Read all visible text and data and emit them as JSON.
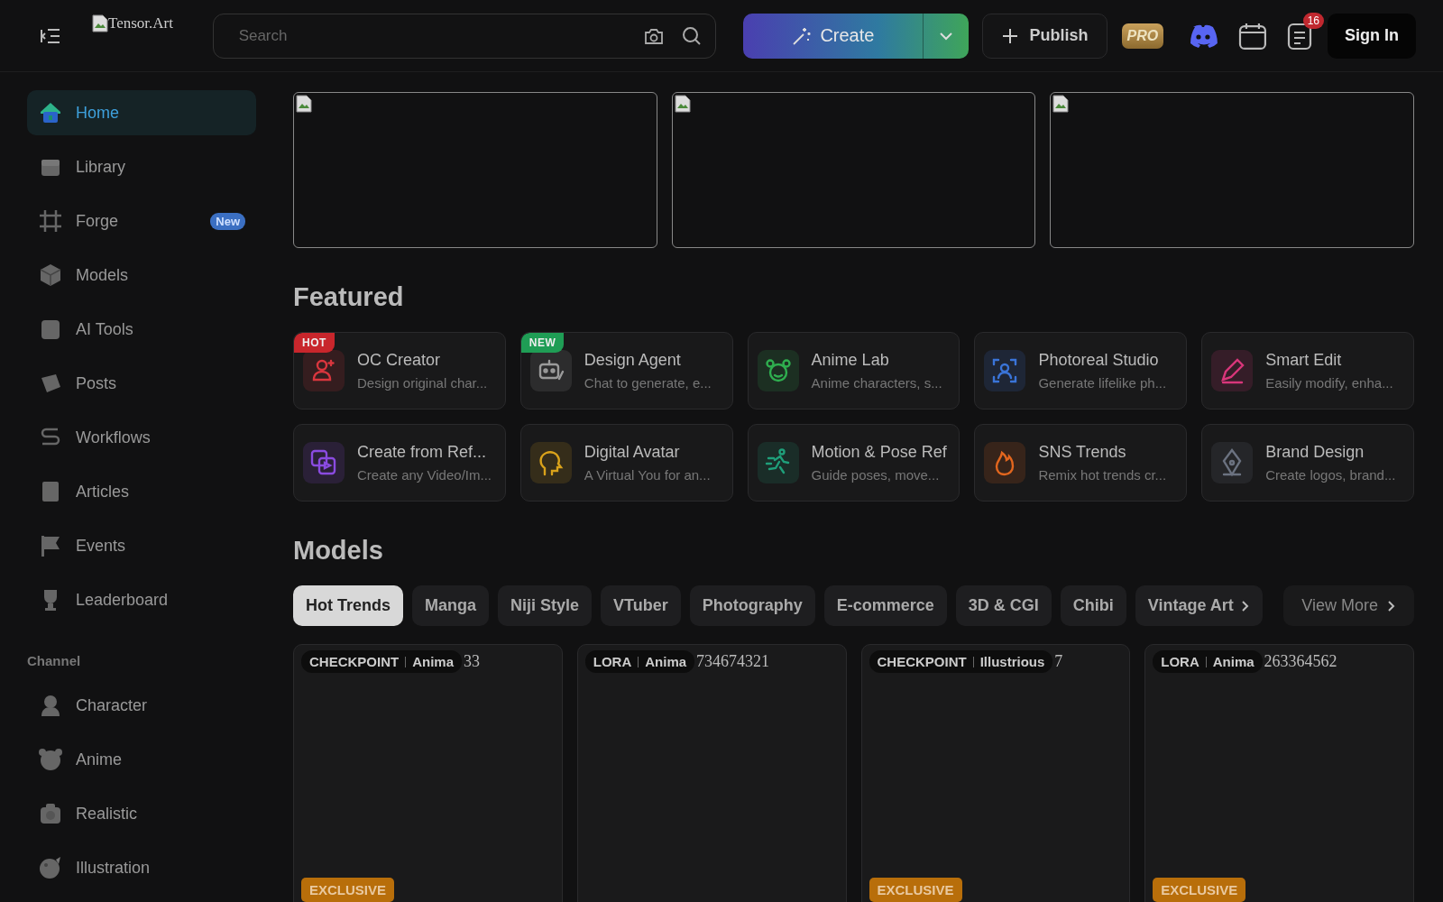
{
  "header": {
    "logo_alt": "Tensor.Art",
    "search": {
      "placeholder": "Search"
    },
    "create_button": "Create",
    "publish_button": "Publish",
    "pro_badge": "PRO",
    "notification_count": "16",
    "sign_in": "Sign In"
  },
  "sidebar": {
    "items": [
      {
        "label": "Home",
        "selected": true
      },
      {
        "label": "Library",
        "selected": false
      },
      {
        "label": "Forge",
        "selected": false,
        "badge": "New"
      },
      {
        "label": "Models",
        "selected": false
      },
      {
        "label": "AI Tools",
        "selected": false
      },
      {
        "label": "Posts",
        "selected": false
      },
      {
        "label": "Workflows",
        "selected": false
      },
      {
        "label": "Articles",
        "selected": false
      },
      {
        "label": "Events",
        "selected": false
      },
      {
        "label": "Leaderboard",
        "selected": false
      }
    ],
    "channel_heading": "Channel",
    "channels": [
      {
        "label": "Character",
        "selected": false
      },
      {
        "label": "Anime",
        "selected": false
      },
      {
        "label": "Realistic",
        "selected": false
      },
      {
        "label": "Illustration",
        "selected": false
      }
    ]
  },
  "banners": [
    {
      "kind": "broken-image"
    },
    {
      "kind": "broken-image"
    },
    {
      "kind": "broken-image"
    }
  ],
  "featured": {
    "title": "Featured",
    "items": [
      {
        "title": "OC Creator",
        "subtitle": "Design original char...",
        "color": "#d9363e",
        "badge": {
          "text": "HOT",
          "kind": "hot"
        }
      },
      {
        "title": "Design Agent",
        "subtitle": "Chat to generate, e...",
        "color": "#9a9a9a",
        "badge": {
          "text": "NEW",
          "kind": "new"
        }
      },
      {
        "title": "Anime Lab",
        "subtitle": "Anime characters, s...",
        "color": "#2fae4f"
      },
      {
        "title": "Photoreal Studio",
        "subtitle": "Generate lifelike ph...",
        "color": "#3a74d8"
      },
      {
        "title": "Smart Edit",
        "subtitle": "Easily modify, enha...",
        "color": "#d8367a"
      },
      {
        "title": "Create from Ref...",
        "subtitle": "Create any Video/Im...",
        "color": "#8a4be0"
      },
      {
        "title": "Digital Avatar",
        "subtitle": "A Virtual You for an...",
        "color": "#d9a21b"
      },
      {
        "title": "Motion & Pose Ref",
        "subtitle": "Guide poses, move...",
        "color": "#1f9f7a"
      },
      {
        "title": "SNS Trends",
        "subtitle": "Remix hot trends cr...",
        "color": "#e2661e"
      },
      {
        "title": "Brand Design",
        "subtitle": "Create logos, brand...",
        "color": "#6b7280"
      }
    ]
  },
  "models": {
    "title": "Models",
    "tabs": [
      {
        "label": "Hot Trends",
        "selected": true
      },
      {
        "label": "Manga",
        "selected": false
      },
      {
        "label": "Niji Style",
        "selected": false
      },
      {
        "label": "VTuber",
        "selected": false
      },
      {
        "label": "Photography",
        "selected": false
      },
      {
        "label": "E-commerce",
        "selected": false
      },
      {
        "label": "3D & CGI",
        "selected": false
      },
      {
        "label": "Chibi",
        "selected": false
      },
      {
        "label": "Vintage Art",
        "selected": false
      }
    ],
    "view_more": "View More",
    "cards": [
      {
        "alt_text": "33",
        "type": "CHECKPOINT",
        "base": "Anima",
        "exclusive": "EXCLUSIVE"
      },
      {
        "alt_text": "734674321",
        "type": "LORA",
        "base": "Anima"
      },
      {
        "alt_text": "7",
        "type": "CHECKPOINT",
        "base": "Illustrious",
        "exclusive": "EXCLUSIVE"
      },
      {
        "alt_text": "263364562",
        "type": "LORA",
        "base": "Anima",
        "exclusive": "EXCLUSIVE"
      }
    ]
  }
}
